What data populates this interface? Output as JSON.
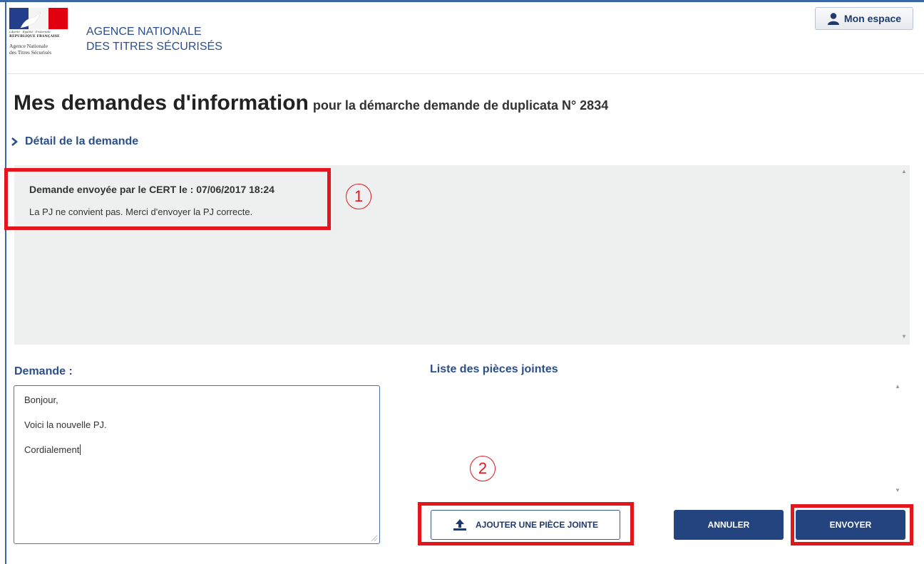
{
  "header": {
    "logo": {
      "motto": "Liberté · Égalité · Fraternité",
      "republic": "RÉPUBLIQUE FRANÇAISE",
      "agency_line1": "Agence Nationale",
      "agency_line2": "des Titres Sécurisés"
    },
    "agency_line1": "AGENCE NATIONALE",
    "agency_line2": "DES TITRES SÉCURISÉS",
    "account_button": "Mon espace"
  },
  "page": {
    "title": "Mes demandes d'information",
    "subtitle": "pour la démarche demande de duplicata N° 2834",
    "detail_toggle": "Détail de la demande"
  },
  "message": {
    "header": "Demande envoyée par le CERT le : 07/06/2017 18:24",
    "body": "La PJ ne convient pas. Merci d'envoyer la PJ correcte."
  },
  "form": {
    "request_label": "Demande :",
    "request_lines": [
      "Bonjour,",
      "Voici la nouvelle PJ.",
      "Cordialement"
    ],
    "attachments_label": "Liste des pièces jointes",
    "attach_button": "AJOUTER UNE PIÈCE JOINTE",
    "cancel_button": "ANNULER",
    "send_button": "ENVOYER"
  },
  "annotations": [
    "1",
    "2"
  ],
  "colors": {
    "brand_blue": "#24447f",
    "link_blue": "#2b4f8a",
    "annotation_red": "#e4161d",
    "panel_gray": "#eef0f0"
  }
}
